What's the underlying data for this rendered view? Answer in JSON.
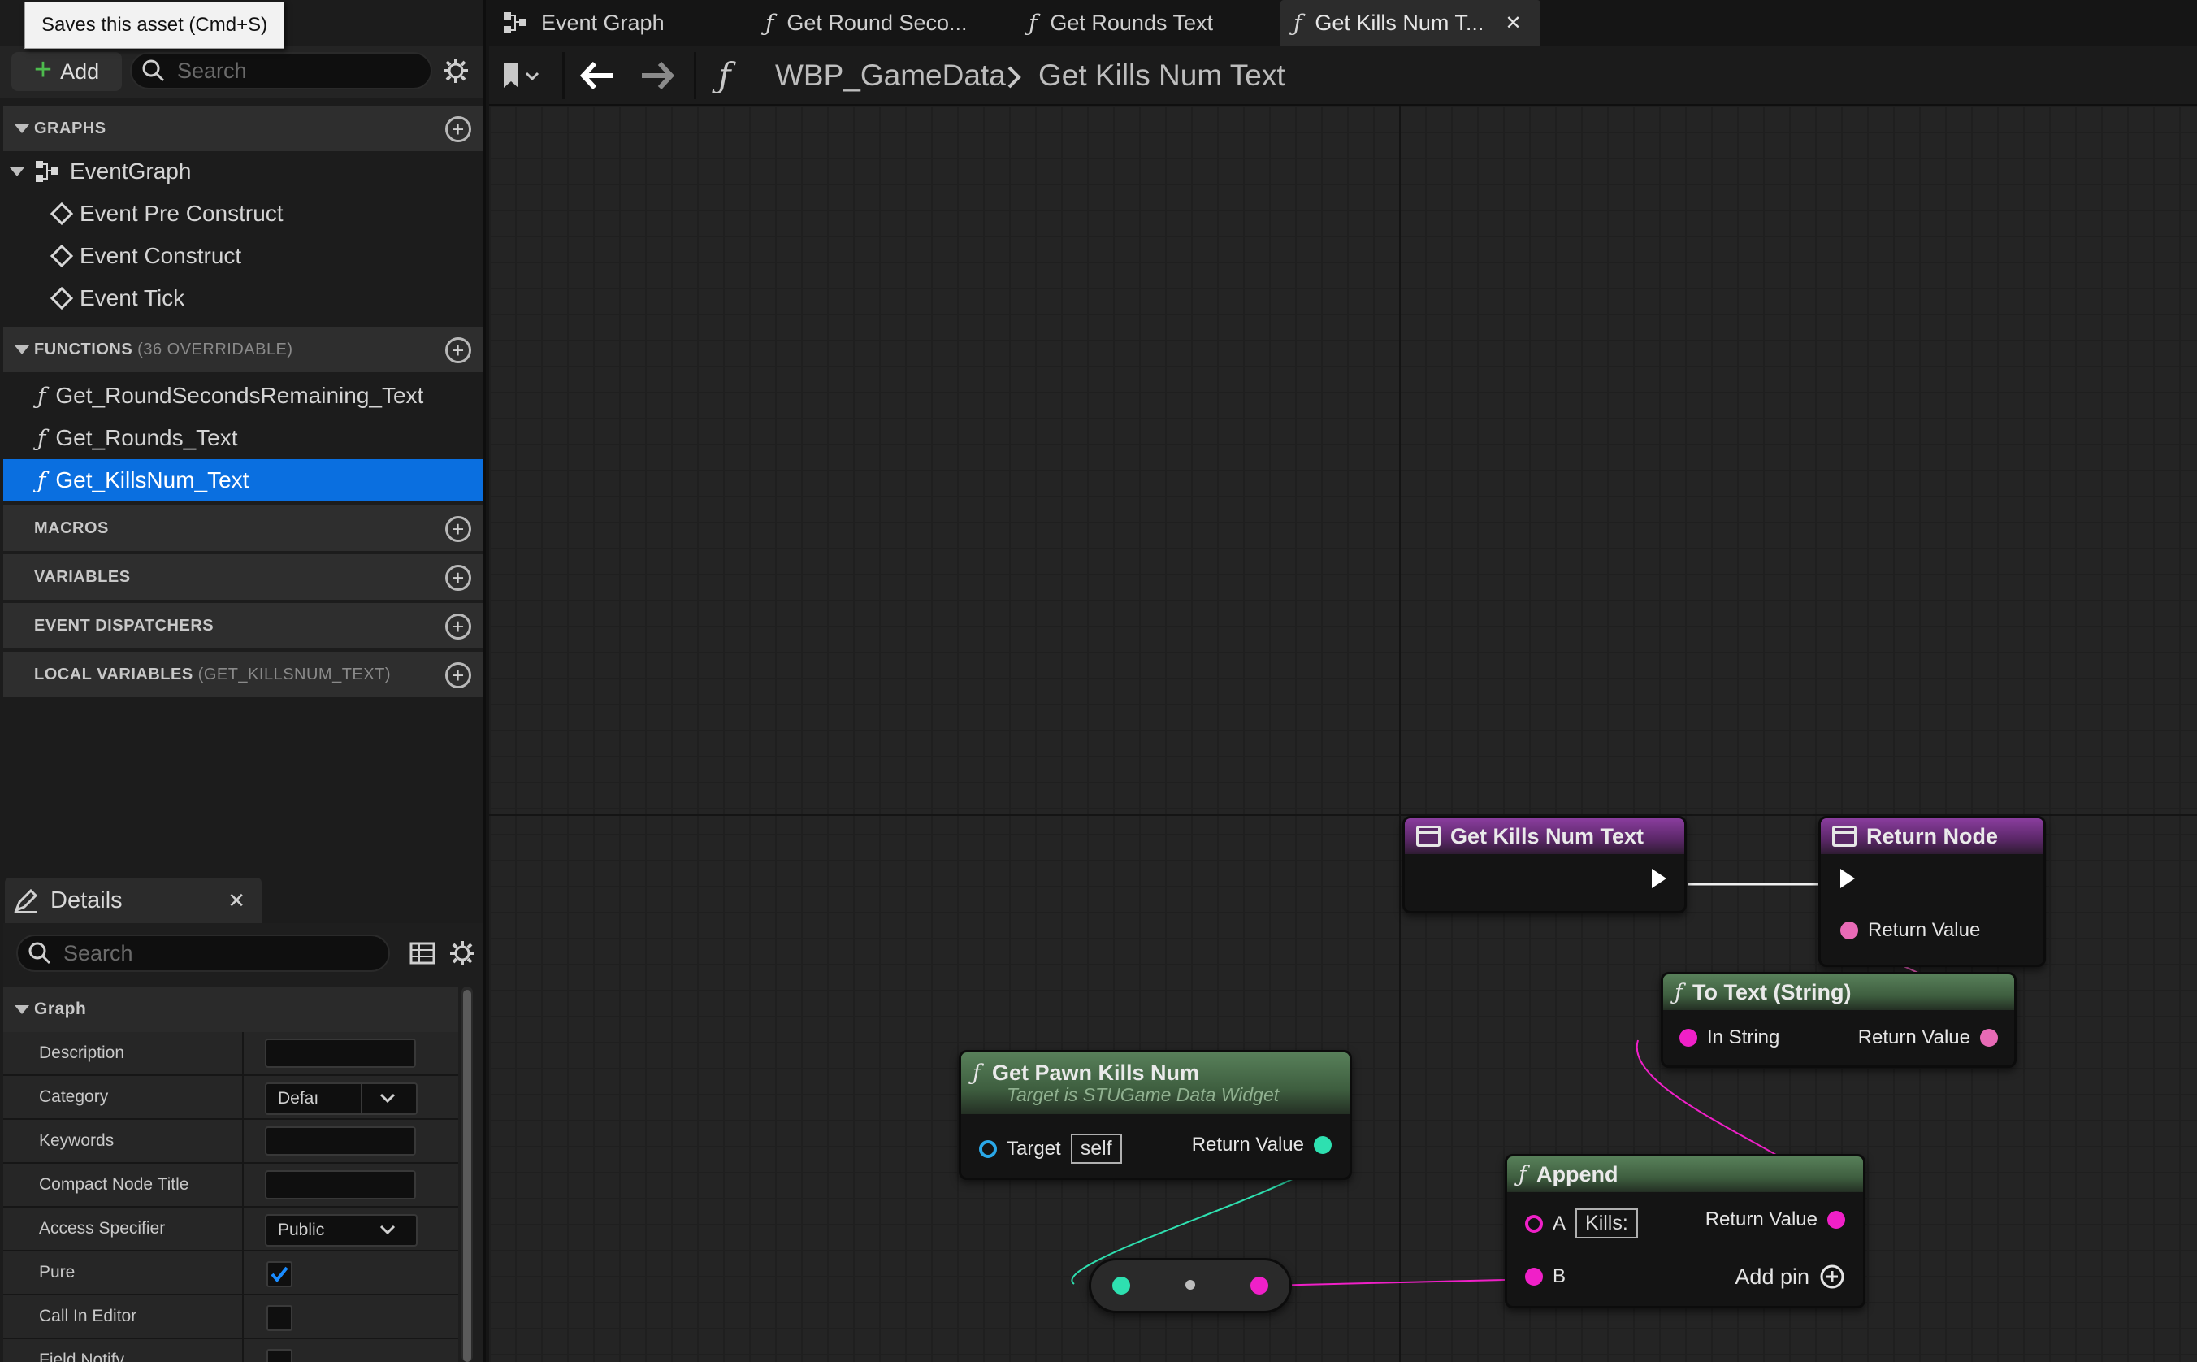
{
  "tooltip": {
    "text": "Saves this asset (Cmd+S)"
  },
  "toolbar": {
    "add_label": "Add",
    "search_placeholder": "Search"
  },
  "sections": {
    "graphs": {
      "label": "GRAPHS"
    },
    "functions": {
      "label": "FUNCTIONS",
      "sub": "(36 OVERRIDABLE)"
    },
    "macros": {
      "label": "MACROS"
    },
    "variables": {
      "label": "VARIABLES"
    },
    "event_dispatchers": {
      "label": "EVENT DISPATCHERS"
    },
    "local_variables": {
      "label": "LOCAL VARIABLES",
      "sub": "(GET_KILLSNUM_TEXT)"
    }
  },
  "graphs": {
    "event_graph": "EventGraph",
    "events": [
      "Event Pre Construct",
      "Event Construct",
      "Event Tick"
    ]
  },
  "functions": [
    "Get_RoundSecondsRemaining_Text",
    "Get_Rounds_Text",
    "Get_KillsNum_Text"
  ],
  "details": {
    "tab_label": "Details",
    "search_placeholder": "Search",
    "group_label": "Graph",
    "rows": {
      "description": "Description",
      "category": "Category",
      "category_value": "Defaı",
      "keywords": "Keywords",
      "compact_title": "Compact Node Title",
      "access": "Access Specifier",
      "access_value": "Public",
      "pure": "Pure",
      "call_in_editor": "Call In Editor",
      "field_notify": "Field Notify"
    }
  },
  "tabs": [
    "Event Graph",
    "Get Round Seco...",
    "Get Rounds Text",
    "Get Kills Num T..."
  ],
  "breadcrumb": {
    "root": "WBP_GameData",
    "current": "Get Kills Num Text"
  },
  "nodes": {
    "entry": {
      "title": "Get Kills Num Text"
    },
    "return": {
      "title": "Return Node",
      "pin": "Return Value"
    },
    "to_text": {
      "title": "To Text (String)",
      "in": "In String",
      "out": "Return Value"
    },
    "get_pawn": {
      "title": "Get Pawn Kills Num",
      "subtitle": "Target is STUGame Data Widget",
      "target": "Target",
      "self": "self",
      "out": "Return Value"
    },
    "append": {
      "title": "Append",
      "a": "A",
      "a_value": "Kills:",
      "b": "B",
      "out": "Return Value",
      "add_pin": "Add pin"
    }
  },
  "colors": {
    "accent": "#0a6fe0",
    "string_pin": "#f020c8",
    "int_pin": "#2ee0b0",
    "object_pin": "#2aa8e8"
  }
}
